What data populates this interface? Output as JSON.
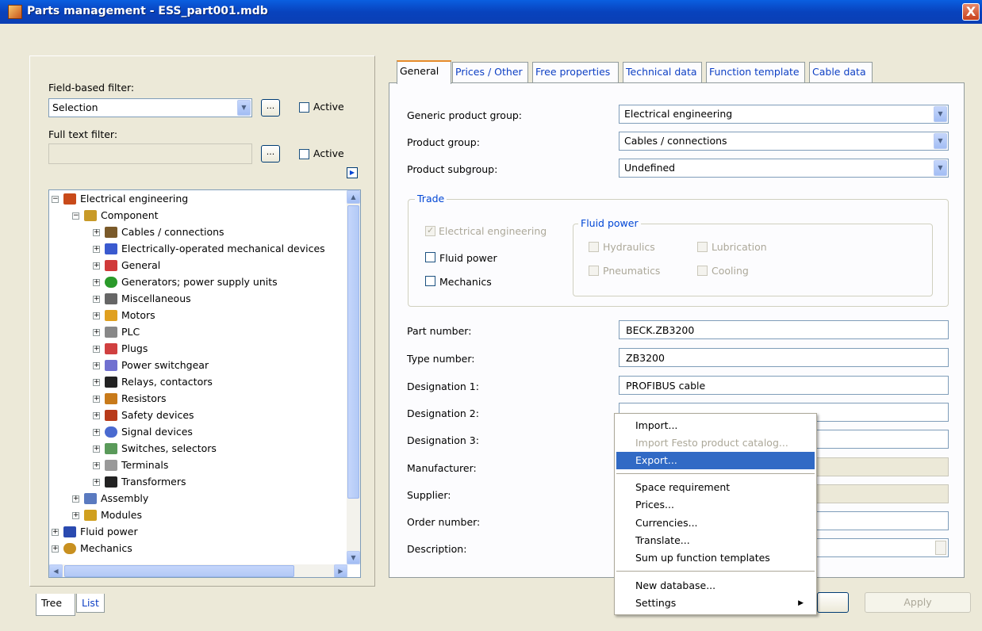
{
  "window": {
    "title": "Parts management - ESS_part001.mdb",
    "close_label": "X"
  },
  "filters": {
    "field_based_label": "Field-based filter:",
    "field_based_value": "Selection",
    "full_text_label": "Full text filter:",
    "full_text_value": "",
    "dots_label": "...",
    "active_label": "Active"
  },
  "tree": {
    "root": "Electrical engineering",
    "component": "Component",
    "items": [
      "Cables / connections",
      "Electrically-operated mechanical devices",
      "General",
      "Generators; power supply units",
      "Miscellaneous",
      "Motors",
      "PLC",
      "Plugs",
      "Power switchgear",
      "Relays, contactors",
      "Resistors",
      "Safety devices",
      "Signal devices",
      "Switches, selectors",
      "Terminals",
      "Transformers"
    ],
    "assembly": "Assembly",
    "modules": "Modules",
    "fluid_power": "Fluid power",
    "mechanics": "Mechanics"
  },
  "bottom_tabs": {
    "tree": "Tree",
    "list": "List"
  },
  "tabs": [
    "General",
    "Prices / Other",
    "Free properties",
    "Technical data",
    "Function template",
    "Cable data"
  ],
  "general": {
    "generic_product_group_label": "Generic product group:",
    "generic_product_group_value": "Electrical engineering",
    "product_group_label": "Product group:",
    "product_group_value": "Cables / connections",
    "product_subgroup_label": "Product subgroup:",
    "product_subgroup_value": "Undefined",
    "trade_title": "Trade",
    "trade_electrical": "Electrical engineering",
    "trade_fluid_power": "Fluid power",
    "trade_mechanics": "Mechanics",
    "fluid_power_title": "Fluid power",
    "hydraulics": "Hydraulics",
    "lubrication": "Lubrication",
    "pneumatics": "Pneumatics",
    "cooling": "Cooling",
    "part_number_label": "Part number:",
    "part_number_value": "BECK.ZB3200",
    "type_number_label": "Type number:",
    "type_number_value": "ZB3200",
    "designation1_label": "Designation 1:",
    "designation1_value": "PROFIBUS cable",
    "designation2_label": "Designation 2:",
    "designation3_label": "Designation 3:",
    "manufacturer_label": "Manufacturer:",
    "supplier_label": "Supplier:",
    "order_number_label": "Order number:",
    "description_label": "Description:"
  },
  "context_menu": {
    "import": "Import...",
    "import_festo": "Import Festo product catalog...",
    "export": "Export...",
    "space_requirement": "Space requirement",
    "prices": "Prices...",
    "currencies": "Currencies...",
    "translate": "Translate...",
    "sum_up": "Sum up function templates",
    "new_database": "New database...",
    "settings": "Settings"
  },
  "buttons": {
    "apply": "Apply"
  }
}
